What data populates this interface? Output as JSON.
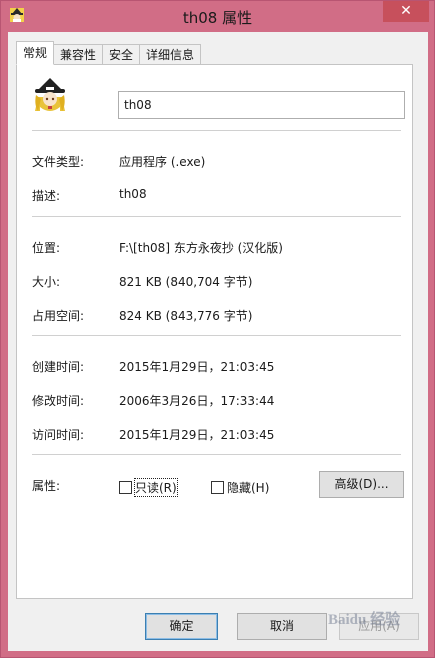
{
  "window": {
    "title": "th08 属性",
    "close_glyph": "✕",
    "accent": "#d16d86",
    "close_color": "#c7505c"
  },
  "tabs": [
    {
      "label": "常规",
      "active": true
    },
    {
      "label": "兼容性",
      "active": false
    },
    {
      "label": "安全",
      "active": false
    },
    {
      "label": "详细信息",
      "active": false
    }
  ],
  "general": {
    "file_icon": "touhou-character-icon",
    "file_name": "th08",
    "file_type_label": "文件类型:",
    "file_type_value": "应用程序 (.exe)",
    "description_label": "描述:",
    "description_value": "th08",
    "location_label": "位置:",
    "location_value": "F:\\[th08] 东方永夜抄 (汉化版)",
    "size_label": "大小:",
    "size_value": "821 KB (840,704 字节)",
    "size_on_disk_label": "占用空间:",
    "size_on_disk_value": "824 KB (843,776 字节)",
    "created_label": "创建时间:",
    "created_value": "2015年1月29日，21:03:45",
    "modified_label": "修改时间:",
    "modified_value": "2006年3月26日，17:33:44",
    "accessed_label": "访问时间:",
    "accessed_value": "2015年1月29日，21:03:45",
    "attributes_label": "属性:",
    "readonly_label": "只读(R)",
    "hidden_label": "隐藏(H)",
    "advanced_button": "高级(D)..."
  },
  "footer": {
    "ok": "确定",
    "cancel": "取消",
    "apply": "应用(A)"
  },
  "watermark": "Baidu 经验"
}
